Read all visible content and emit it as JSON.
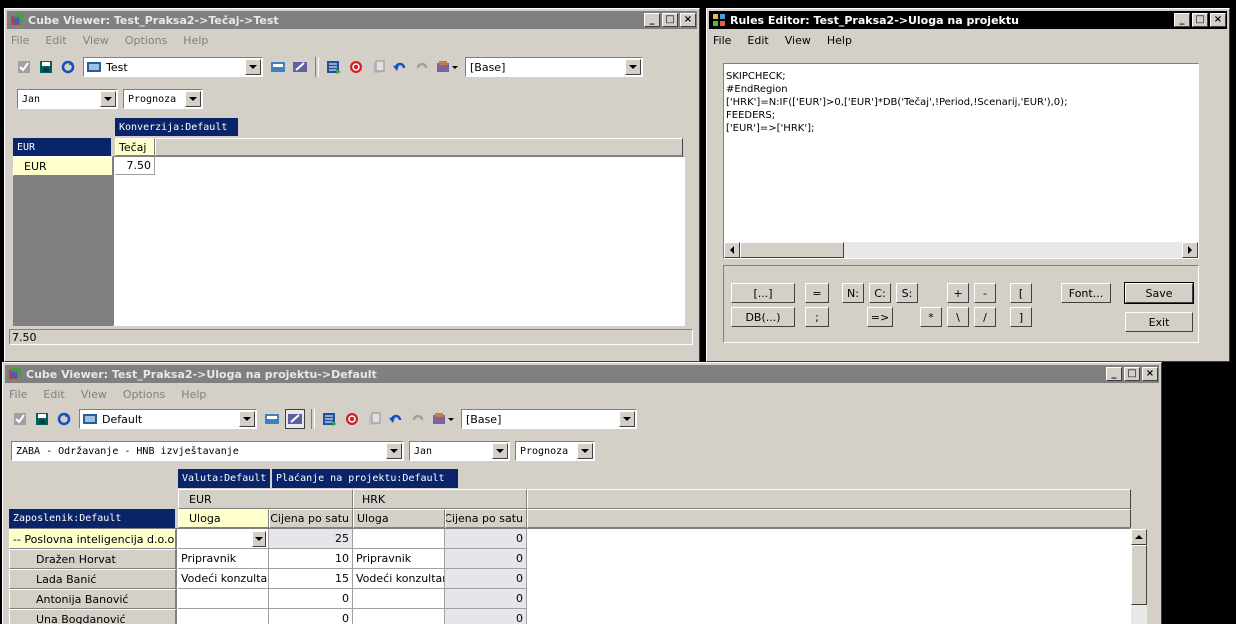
{
  "cube1": {
    "title": "Cube Viewer: Test_Praksa2->Tečaj->Test",
    "menu": [
      "File",
      "Edit",
      "View",
      "Options",
      "Help"
    ],
    "view_name": "Test",
    "subset": "[Base]",
    "filters": [
      "Jan",
      "Prognoza"
    ],
    "col_dim": "Konverzija:Default",
    "row_dim": "EUR",
    "col_header": "Tečaj",
    "row_label": "EUR",
    "value": "7.50",
    "status": "7.50"
  },
  "rules": {
    "title": "Rules Editor:  Test_Praksa2->Uloga na projektu",
    "menu": [
      "File",
      "Edit",
      "View",
      "Help"
    ],
    "lines": [
      "SKIPCHECK;",
      "#EndRegion",
      "['HRK']=N:IF(['EUR']>0,['EUR']*DB('Tečaj',!Period,!Scenarij,'EUR'),0);",
      "FEEDERS;",
      "['EUR']=>['HRK'];"
    ],
    "buttons": {
      "bracket": "[...]",
      "db": "DB(...)",
      "eq": "=",
      "semi": ";",
      "n": "N:",
      "c": "C:",
      "s": "S:",
      "feed": "=>",
      "plus": "+",
      "minus": "-",
      "mul": "*",
      "bslash": "\\",
      "slash": "/",
      "lbr": "[",
      "rbr": "]",
      "font": "Font...",
      "save": "Save",
      "exit": "Exit"
    }
  },
  "cube2": {
    "title": "Cube Viewer: Test_Praksa2->Uloga na projektu->Default",
    "menu": [
      "File",
      "Edit",
      "View",
      "Options",
      "Help"
    ],
    "view_name": "Default",
    "subset": "[Base]",
    "filters": [
      "ZABA - Održavanje - HNB izvještavanje",
      "Jan",
      "Prognoza"
    ],
    "col_dims": [
      "Valuta:Default",
      "Plaćanje na projektu:Default"
    ],
    "row_dim": "Zaposlenik:Default",
    "currencies": [
      "EUR",
      "HRK"
    ],
    "measures": [
      "Uloga",
      "Cijena po satu",
      "Uloga",
      "Cijena po satu"
    ],
    "rows": [
      {
        "name": "-- Poslovna inteligencija d.o.o.",
        "eur_role": "",
        "eur_price": "25",
        "hrk_role": "",
        "hrk_price": "0"
      },
      {
        "name": "Dražen Horvat",
        "eur_role": "Pripravnik",
        "eur_price": "10",
        "hrk_role": "Pripravnik",
        "hrk_price": "0"
      },
      {
        "name": "Lada Banić",
        "eur_role": "Vodeći konzultant",
        "eur_price": "15",
        "hrk_role": "Vodeći konzultant",
        "hrk_price": "0"
      },
      {
        "name": "Antonija Banović",
        "eur_role": "",
        "eur_price": "0",
        "hrk_role": "",
        "hrk_price": "0"
      },
      {
        "name": "Una Bogdanović",
        "eur_role": "",
        "eur_price": "0",
        "hrk_role": "",
        "hrk_price": "0"
      }
    ]
  }
}
